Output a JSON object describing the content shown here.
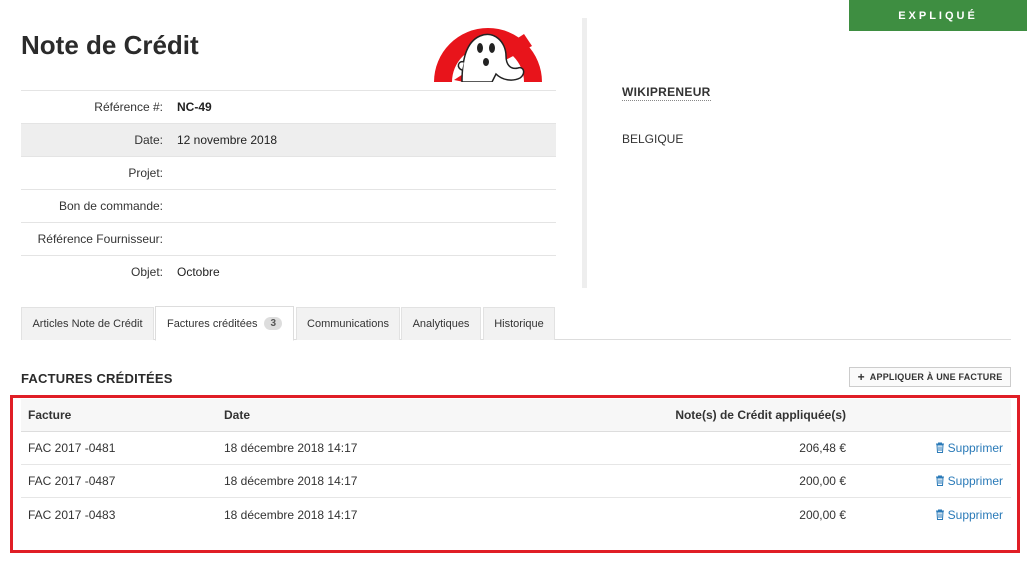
{
  "status_banner": "EXPLIQUÉ",
  "page_title": "Note de Crédit",
  "info": [
    {
      "label": "Référence #:",
      "value": "NC-49"
    },
    {
      "label": "Date:",
      "value": "12 novembre 2018"
    },
    {
      "label": "Projet:",
      "value": ""
    },
    {
      "label": "Bon de commande:",
      "value": ""
    },
    {
      "label": "Référence Fournisseur:",
      "value": ""
    },
    {
      "label": "Objet:",
      "value": "Octobre"
    }
  ],
  "supplier": {
    "name": "WIKIPRENEUR",
    "country": "BELGIQUE"
  },
  "tabs": [
    {
      "label": "Articles Note de Crédit"
    },
    {
      "label": "Factures créditées",
      "badge": "3"
    },
    {
      "label": "Communications"
    },
    {
      "label": "Analytiques"
    },
    {
      "label": "Historique"
    }
  ],
  "section": {
    "title": "FACTURES CRÉDITÉES",
    "apply_button": "APPLIQUER À UNE FACTURE"
  },
  "table": {
    "headers": [
      "Facture",
      "Date",
      "Note(s) de Crédit appliquée(s)"
    ],
    "rows": [
      {
        "invoice": "FAC 2017 -0481",
        "date": "18 décembre 2018 14:17",
        "amount": "206,48 €",
        "action": "Supprimer"
      },
      {
        "invoice": "FAC 2017 -0487",
        "date": "18 décembre 2018 14:17",
        "amount": "200,00 €",
        "action": "Supprimer"
      },
      {
        "invoice": "FAC 2017 -0483",
        "date": "18 décembre 2018 14:17",
        "amount": "200,00 €",
        "action": "Supprimer"
      }
    ]
  },
  "colors": {
    "banner": "#3e8e41",
    "highlight": "#e01e26",
    "link": "#2a7ab8"
  }
}
